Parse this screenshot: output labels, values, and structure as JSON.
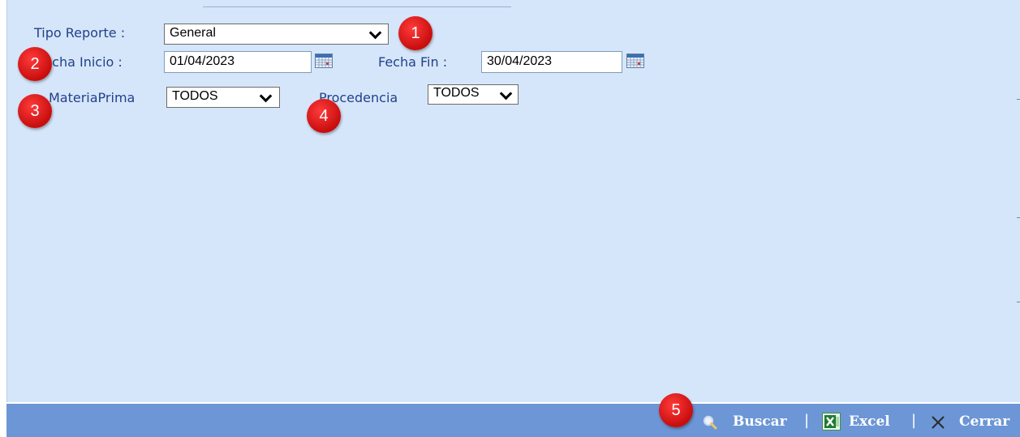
{
  "form": {
    "tipo_reporte_label": "Tipo Reporte :",
    "tipo_reporte_value": "General",
    "fecha_inicio_label": "Fecha Inicio :",
    "fecha_inicio_value": "01/04/2023",
    "fecha_fin_label": "Fecha Fin :",
    "fecha_fin_value": "30/04/2023",
    "materia_prima_label": "MateriaPrima",
    "materia_prima_value": "TODOS",
    "procedencia_label": "Procedencia",
    "procedencia_value": "TODOS"
  },
  "badges": [
    "1",
    "2",
    "3",
    "4",
    "5"
  ],
  "toolbar": {
    "buscar_label": "Buscar",
    "excel_label": "Excel",
    "cerrar_label": "Cerrar",
    "separator": "|"
  },
  "colors": {
    "panel_bg": "#d6e6fa",
    "label_text": "#23418a",
    "toolbar_bg": "#6d96d6",
    "badge_red": "#d81414"
  },
  "icons": {
    "calendar": "calendar-icon",
    "search": "magnifier-icon",
    "excel": "excel-icon",
    "close": "close-x-icon",
    "dropdown": "chevron-down-icon"
  }
}
